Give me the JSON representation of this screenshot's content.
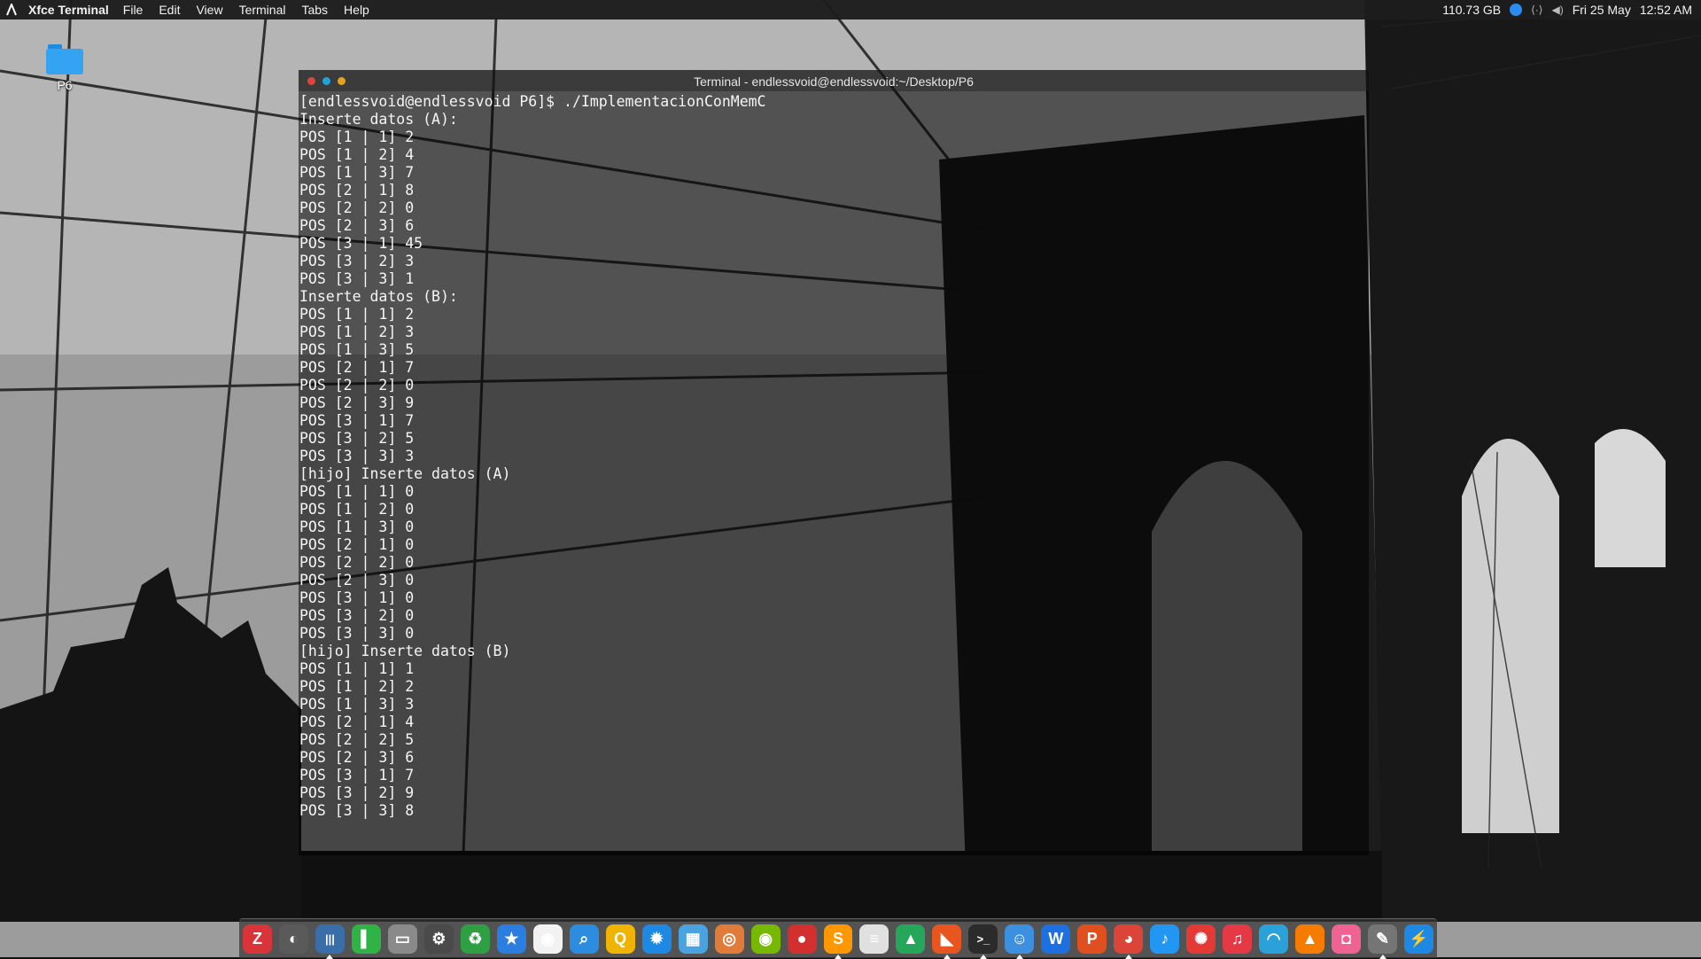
{
  "top_panel": {
    "app_name": "Xfce Terminal",
    "menus": [
      "File",
      "Edit",
      "View",
      "Terminal",
      "Tabs",
      "Help"
    ],
    "disk_free": "110.73 GB",
    "date": "Fri 25 May",
    "time": "12:52 AM"
  },
  "desktop": {
    "folder_label": "P6"
  },
  "terminal": {
    "title": "Terminal - endlessvoid@endlessvoid:~/Desktop/P6",
    "lines": [
      "[endlessvoid@endlessvoid P6]$ ./ImplementacionConMemC",
      "Inserte datos (A):",
      "POS [1 | 1] 2",
      "POS [1 | 2] 4",
      "POS [1 | 3] 7",
      "POS [2 | 1] 8",
      "POS [2 | 2] 0",
      "POS [2 | 3] 6",
      "POS [3 | 1] 45",
      "POS [3 | 2] 3",
      "POS [3 | 3] 1",
      "Inserte datos (B):",
      "POS [1 | 1] 2",
      "POS [1 | 2] 3",
      "POS [1 | 3] 5",
      "POS [2 | 1] 7",
      "POS [2 | 2] 0",
      "POS [2 | 3] 9",
      "POS [3 | 1] 7",
      "POS [3 | 2] 5",
      "POS [3 | 3] 3",
      "[hijo] Inserte datos (A)",
      "POS [1 | 1] 0",
      "POS [1 | 2] 0",
      "POS [1 | 3] 0",
      "POS [2 | 1] 0",
      "POS [2 | 2] 0",
      "POS [2 | 3] 0",
      "POS [3 | 1] 0",
      "POS [3 | 2] 0",
      "POS [3 | 3] 0",
      "[hijo] Inserte datos (B)",
      "POS [1 | 1] 1",
      "POS [1 | 2] 2",
      "POS [1 | 3] 3",
      "POS [2 | 1] 4",
      "POS [2 | 2] 5",
      "POS [2 | 3] 6",
      "POS [3 | 1] 7",
      "POS [3 | 2] 9",
      "POS [3 | 3] 8"
    ]
  },
  "dock": {
    "items": [
      {
        "name": "filezilla-icon",
        "glyph": "Z",
        "color": "#d9343a",
        "running": false
      },
      {
        "name": "inkscape-icon",
        "glyph": "◐",
        "color": "#5a5a5a",
        "running": false
      },
      {
        "name": "equalizer-icon",
        "glyph": "|||",
        "color": "#3a6ea8",
        "running": true
      },
      {
        "name": "notes-icon",
        "glyph": "▌",
        "color": "#2fb344",
        "running": false
      },
      {
        "name": "disk-icon",
        "glyph": "▭",
        "color": "#8a8a8a",
        "running": false
      },
      {
        "name": "settings-icon",
        "glyph": "⚙",
        "color": "#4a4a4a",
        "running": false
      },
      {
        "name": "recycle-icon",
        "glyph": "♻",
        "color": "#2ea043",
        "running": false
      },
      {
        "name": "star-icon",
        "glyph": "★",
        "color": "#2b7de0",
        "running": false
      },
      {
        "name": "eye-icon",
        "glyph": "◉",
        "color": "#f2f2f2",
        "running": false
      },
      {
        "name": "search-icon",
        "glyph": "⌕",
        "color": "#2b8ce0",
        "running": false
      },
      {
        "name": "magnifier-icon",
        "glyph": "Q",
        "color": "#f0b400",
        "running": false
      },
      {
        "name": "gear-blue-icon",
        "glyph": "✹",
        "color": "#1e88e5",
        "running": false
      },
      {
        "name": "photos-icon",
        "glyph": "▦",
        "color": "#4aa3df",
        "running": false
      },
      {
        "name": "disc-icon",
        "glyph": "◎",
        "color": "#e07b39",
        "running": false
      },
      {
        "name": "nvidia-icon",
        "glyph": "◉",
        "color": "#76b900",
        "running": false
      },
      {
        "name": "record-icon",
        "glyph": "●",
        "color": "#d32f2f",
        "running": false
      },
      {
        "name": "sublime-icon",
        "glyph": "S",
        "color": "#ff9800",
        "running": true
      },
      {
        "name": "text-editor-icon",
        "glyph": "≡",
        "color": "#e0e0e0",
        "running": false
      },
      {
        "name": "monitor-icon",
        "glyph": "▲",
        "color": "#26a65b",
        "running": false
      },
      {
        "name": "app-orange-icon",
        "glyph": "◣",
        "color": "#e8551f",
        "running": true
      },
      {
        "name": "terminal-icon",
        "glyph": ">_",
        "color": "#2b2b2b",
        "running": true
      },
      {
        "name": "finder-icon",
        "glyph": "☺",
        "color": "#3d8fe0",
        "running": true
      },
      {
        "name": "wps-writer-icon",
        "glyph": "W",
        "color": "#1e6fe0",
        "running": false
      },
      {
        "name": "wps-presentation-icon",
        "glyph": "P",
        "color": "#e0501e",
        "running": false
      },
      {
        "name": "chrome-icon",
        "glyph": "◕",
        "color": "#db4437",
        "running": true
      },
      {
        "name": "music-icon",
        "glyph": "♪",
        "color": "#2196f3",
        "running": false
      },
      {
        "name": "bulb-icon",
        "glyph": "✺",
        "color": "#e53935",
        "running": false
      },
      {
        "name": "itunes-icon",
        "glyph": "♫",
        "color": "#e53945",
        "running": false
      },
      {
        "name": "wave-icon",
        "glyph": "◠",
        "color": "#2aa1d9",
        "running": false
      },
      {
        "name": "vlc-icon",
        "glyph": "▲",
        "color": "#f57c00",
        "running": false
      },
      {
        "name": "camera-icon",
        "glyph": "◘",
        "color": "#f06292",
        "running": false
      },
      {
        "name": "gimp-icon",
        "glyph": "✎",
        "color": "#757575",
        "running": true
      },
      {
        "name": "messenger-icon",
        "glyph": "⚡",
        "color": "#1e88e5",
        "running": false
      }
    ]
  }
}
